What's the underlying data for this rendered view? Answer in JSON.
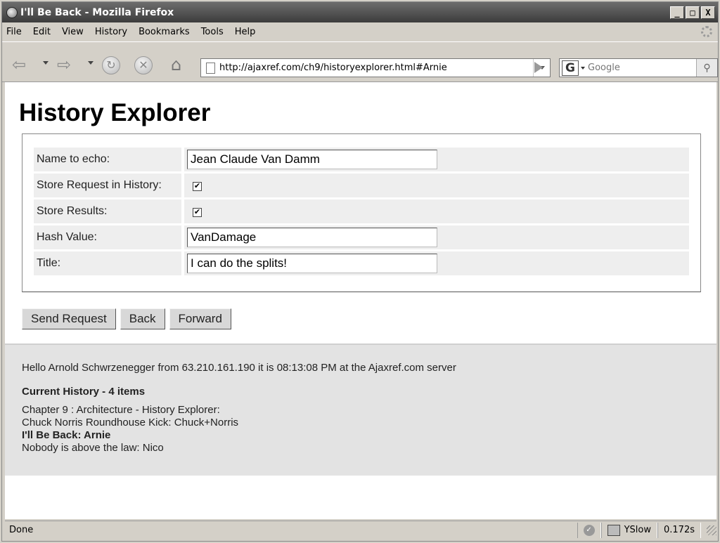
{
  "window": {
    "title": "I'll Be Back - Mozilla Firefox",
    "buttons": {
      "minimize": "_",
      "maximize": "□",
      "close": "X"
    }
  },
  "menubar": {
    "items": [
      "File",
      "Edit",
      "View",
      "History",
      "Bookmarks",
      "Tools",
      "Help"
    ]
  },
  "navbar": {
    "url": "http://ajaxref.com/ch9/historyexplorer.html#Arnie",
    "search_placeholder": "Google",
    "search_engine_glyph": "G",
    "icons": [
      "back-icon",
      "forward-icon",
      "reload-icon",
      "stop-icon",
      "home-icon",
      "page-icon",
      "go-icon",
      "search-icon"
    ]
  },
  "page": {
    "title": "History Explorer",
    "form": {
      "name_label": "Name to echo:",
      "name_value": "Jean Claude Van Damm",
      "store_request_label": "Store Request in History:",
      "store_request_checked": true,
      "store_results_label": "Store Results:",
      "store_results_checked": true,
      "hash_label": "Hash Value:",
      "hash_value": "VanDamage",
      "title_label": "Title:",
      "title_value": "I can do the splits!"
    },
    "buttons": {
      "send": "Send Request",
      "back": "Back",
      "forward": "Forward"
    },
    "result": {
      "hello": "Hello Arnold Schwrzenegger from 63.210.161.190 it is 08:13:08 PM at the Ajaxref.com server",
      "history_heading": "Current History - 4 items",
      "history_items": [
        {
          "text": "Chapter 9 : Architecture - History Explorer:",
          "current": false
        },
        {
          "text": "Chuck Norris Roundhouse Kick: Chuck+Norris",
          "current": false
        },
        {
          "text": "I'll Be Back: Arnie",
          "current": true
        },
        {
          "text": "Nobody is above the law: Nico",
          "current": false
        }
      ]
    }
  },
  "statusbar": {
    "status": "Done",
    "yslow_label": "YSlow",
    "load_time": "0.172s"
  }
}
